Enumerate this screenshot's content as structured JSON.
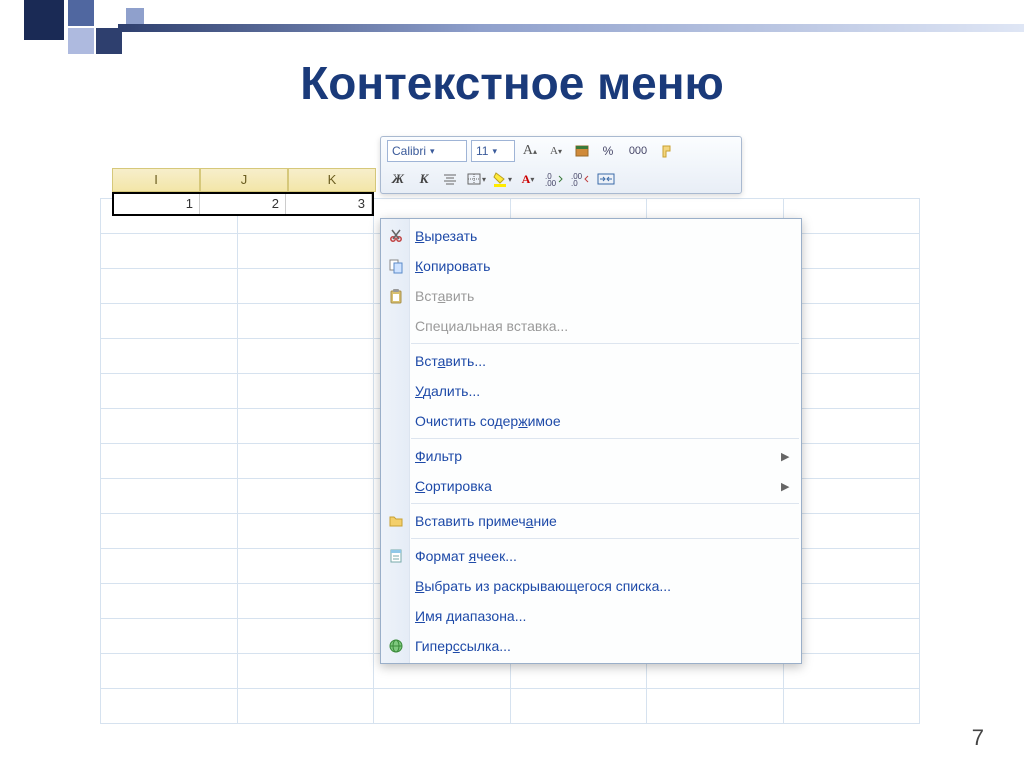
{
  "slide": {
    "title": "Контекстное меню",
    "page_number": "7"
  },
  "sheet": {
    "columns": [
      "I",
      "J",
      "K"
    ],
    "selected_values": [
      "1",
      "2",
      "3"
    ]
  },
  "mini_toolbar": {
    "font_name": "Calibri",
    "font_size": "11",
    "percent_label": "%",
    "thousands_label": "000"
  },
  "context_menu": {
    "groups": [
      [
        {
          "id": "cut",
          "label": "Вырезать",
          "underline": 0,
          "icon": "scissors",
          "enabled": true
        },
        {
          "id": "copy",
          "label": "Копировать",
          "underline": 0,
          "icon": "copy",
          "enabled": true
        },
        {
          "id": "paste",
          "label": "Вставить",
          "underline": 3,
          "icon": "paste",
          "enabled": false
        },
        {
          "id": "paste-special",
          "label": "Специальная вставка...",
          "underline": -1,
          "icon": "",
          "enabled": false
        }
      ],
      [
        {
          "id": "insert",
          "label": "Вставить...",
          "underline": 3,
          "icon": "",
          "enabled": true
        },
        {
          "id": "delete",
          "label": "Удалить...",
          "underline": 0,
          "icon": "",
          "enabled": true
        },
        {
          "id": "clear",
          "label": "Очистить содержимое",
          "underline": 14,
          "icon": "",
          "enabled": true
        }
      ],
      [
        {
          "id": "filter",
          "label": "Фильтр",
          "underline": 0,
          "icon": "",
          "enabled": true,
          "submenu": true
        },
        {
          "id": "sort",
          "label": "Сортировка",
          "underline": 0,
          "icon": "",
          "enabled": true,
          "submenu": true
        }
      ],
      [
        {
          "id": "comment",
          "label": "Вставить примечание",
          "underline": 15,
          "icon": "folder",
          "enabled": true
        }
      ],
      [
        {
          "id": "format-cells",
          "label": "Формат ячеек...",
          "underline": 7,
          "icon": "props",
          "enabled": true
        },
        {
          "id": "pick-list",
          "label": "Выбрать из раскрывающегося списка...",
          "underline": 0,
          "icon": "",
          "enabled": true
        },
        {
          "id": "range-name",
          "label": "Имя диапазона...",
          "underline": 0,
          "icon": "",
          "enabled": true
        },
        {
          "id": "hyperlink",
          "label": "Гиперссылка...",
          "underline": 5,
          "icon": "globe",
          "enabled": true
        }
      ]
    ]
  }
}
